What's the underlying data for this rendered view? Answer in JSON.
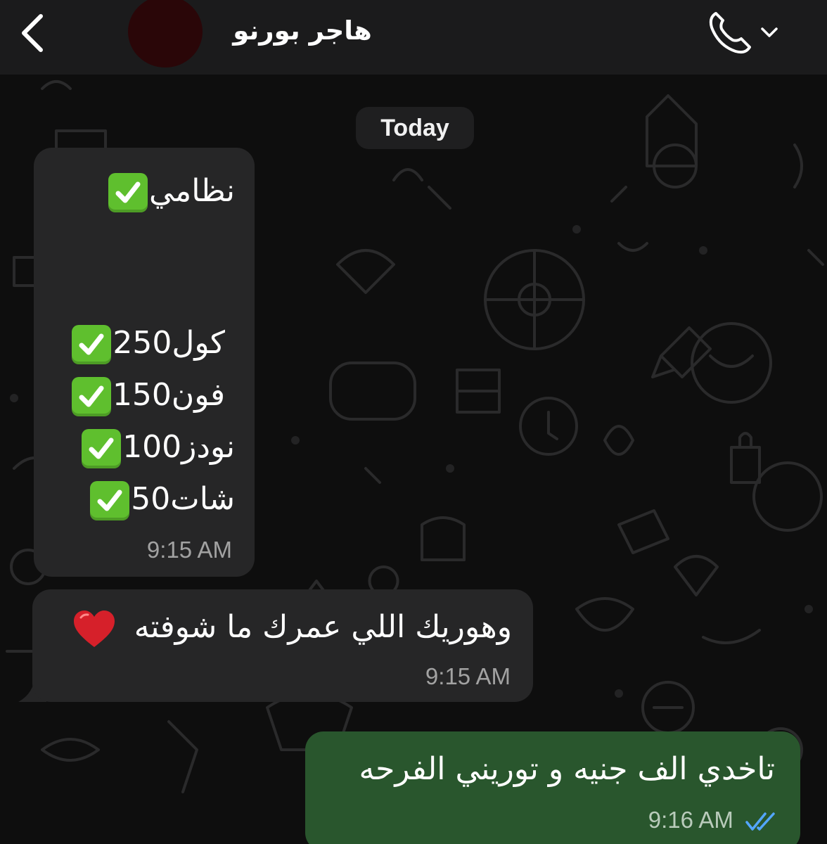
{
  "header": {
    "contact_name": "هاجر بورنو"
  },
  "date_chip": "Today",
  "messages": [
    {
      "direction": "incoming",
      "lines": [
        "نظامي",
        "كول250",
        "فون150",
        "نودز100",
        "شات50"
      ],
      "time": "9:15 AM"
    },
    {
      "direction": "incoming",
      "text": "وهوريك اللي عمرك ما شوفته",
      "time": "9:15 AM"
    },
    {
      "direction": "outgoing",
      "text": "تاخدي الف جنيه و توريني الفرحه",
      "time": "9:16 AM",
      "status": "read"
    }
  ],
  "icons": {
    "back": "chevron-left-icon",
    "call": "phone-icon",
    "call_menu": "chevron-down-icon",
    "check": "check-mark-button-emoji",
    "heart": "red-heart-emoji",
    "read_ticks": "double-check-icon"
  },
  "colors": {
    "header_bg": "#1b1b1c",
    "incoming_bubble": "#262627",
    "outgoing_bubble": "#29562d",
    "check_green": "#5fbf2e",
    "read_tick": "#53a6ff",
    "time_text": "#a2a2a2"
  }
}
